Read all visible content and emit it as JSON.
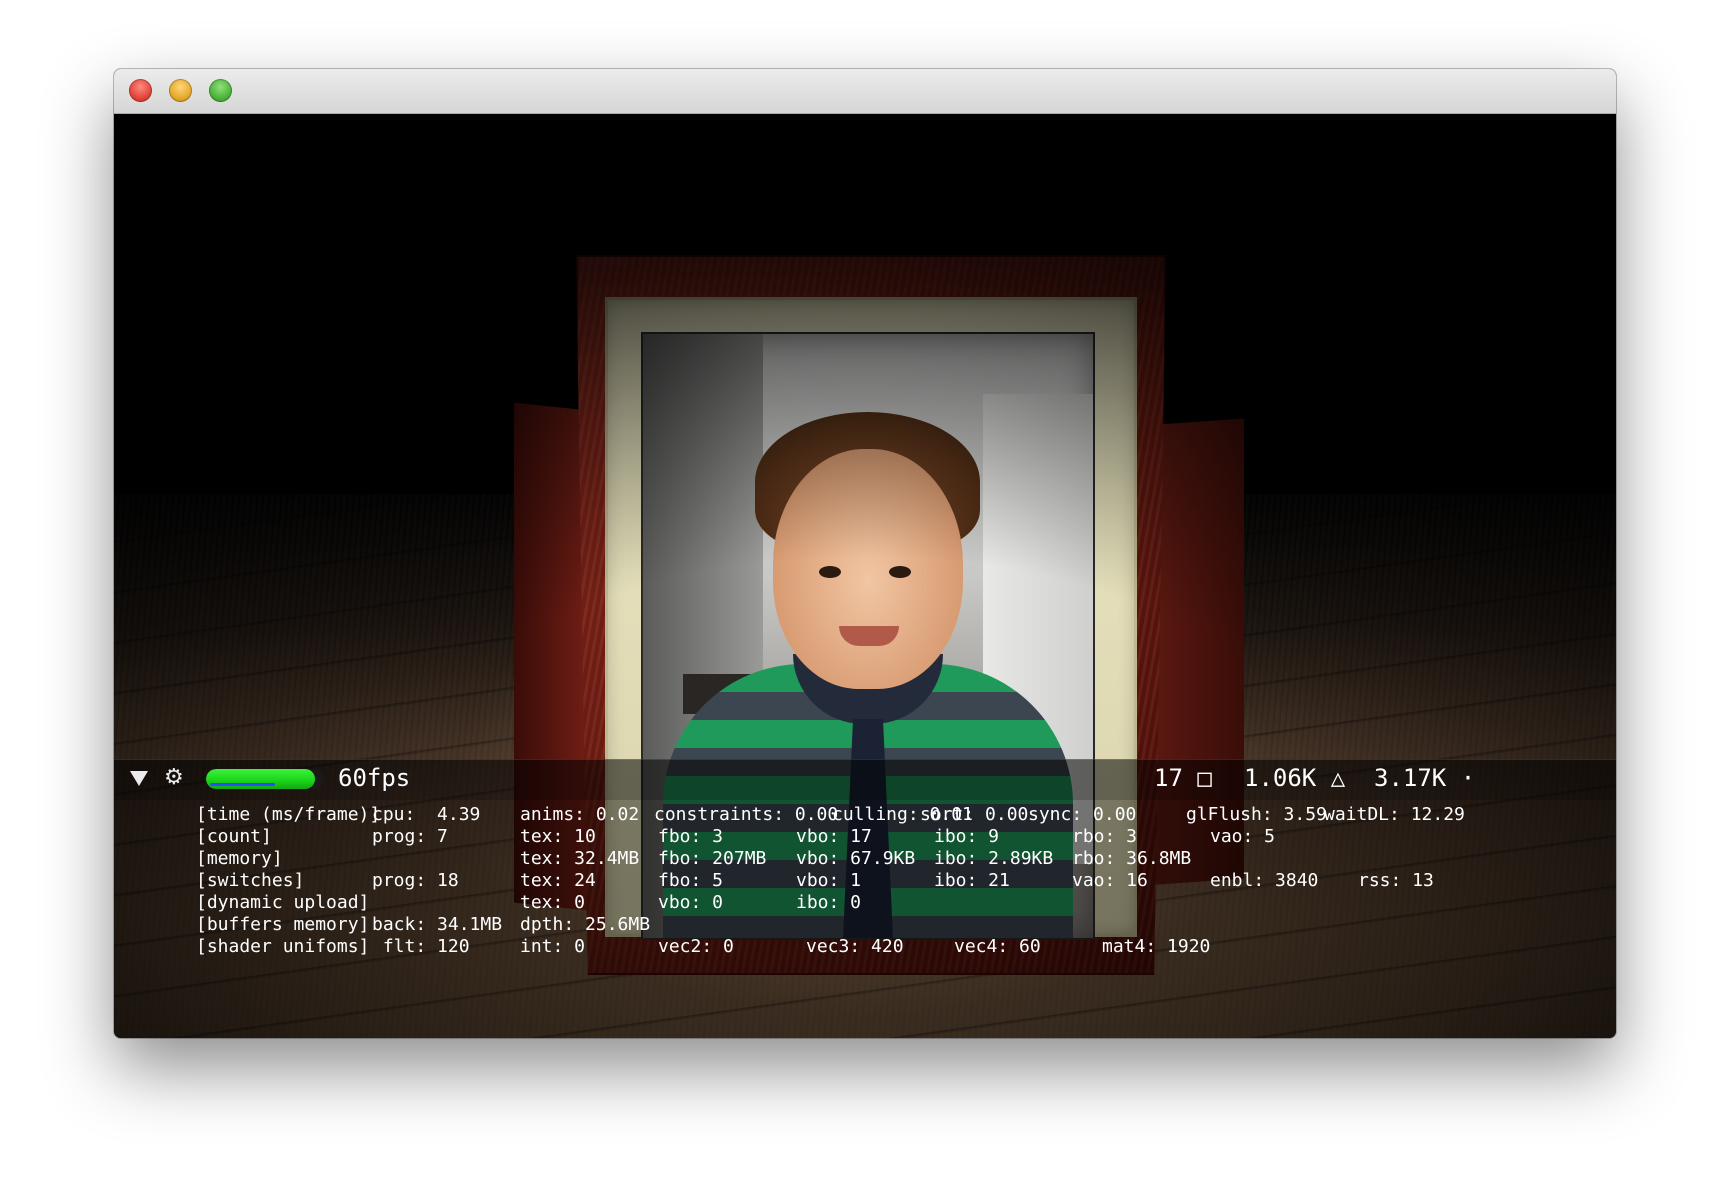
{
  "window": {
    "controls": {
      "close": "close-button",
      "minimize": "minimize-button",
      "zoom": "zoom-button"
    }
  },
  "stats": {
    "fps_label": "60fps",
    "fps_fill_fraction": 0.92,
    "counters": {
      "nodes": "17 □",
      "triangles": "1.06K △",
      "points": "3.17K ·"
    },
    "rows": [
      {
        "label": "[time (ms/frame)]",
        "cells": [
          "cpu:  4.39",
          "anims: 0.02",
          "constraints: 0.00",
          "culling: 0.01",
          "sort: 0.00",
          "sync: 0.00",
          "glFlush: 3.59",
          "waitDL: 12.29"
        ]
      },
      {
        "label": "[count]",
        "cells": [
          "prog: 7",
          "tex: 10",
          "fbo: 3",
          "vbo: 17",
          "ibo: 9",
          "rbo: 3",
          "vao: 5"
        ]
      },
      {
        "label": "[memory]",
        "cells": [
          "",
          "tex: 32.4MB",
          "fbo: 207MB",
          "vbo: 67.9KB",
          "ibo: 2.89KB",
          "rbo: 36.8MB"
        ]
      },
      {
        "label": "[switches]",
        "cells": [
          "prog: 18",
          "tex: 24",
          "fbo: 5",
          "vbo: 1",
          "ibo: 21",
          "vao: 16",
          "enbl: 3840",
          "rss: 13"
        ]
      },
      {
        "label": "[dynamic upload]",
        "cells": [
          "",
          "tex: 0",
          "vbo: 0",
          "ibo: 0"
        ]
      },
      {
        "label": "[buffers memory]",
        "cells": [
          "back: 34.1MB",
          "dpth: 25.6MB"
        ]
      },
      {
        "label": "[shader unifoms]",
        "cells": [
          " flt: 120",
          "int: 0",
          "vec2: 0",
          "vec3: 420",
          "vec4: 60",
          "mat4: 1920"
        ]
      }
    ]
  },
  "colors": {
    "fps_bar": "#1bd21b",
    "frame_wood": "#6a1a10",
    "mat": "#e4dfb8"
  }
}
